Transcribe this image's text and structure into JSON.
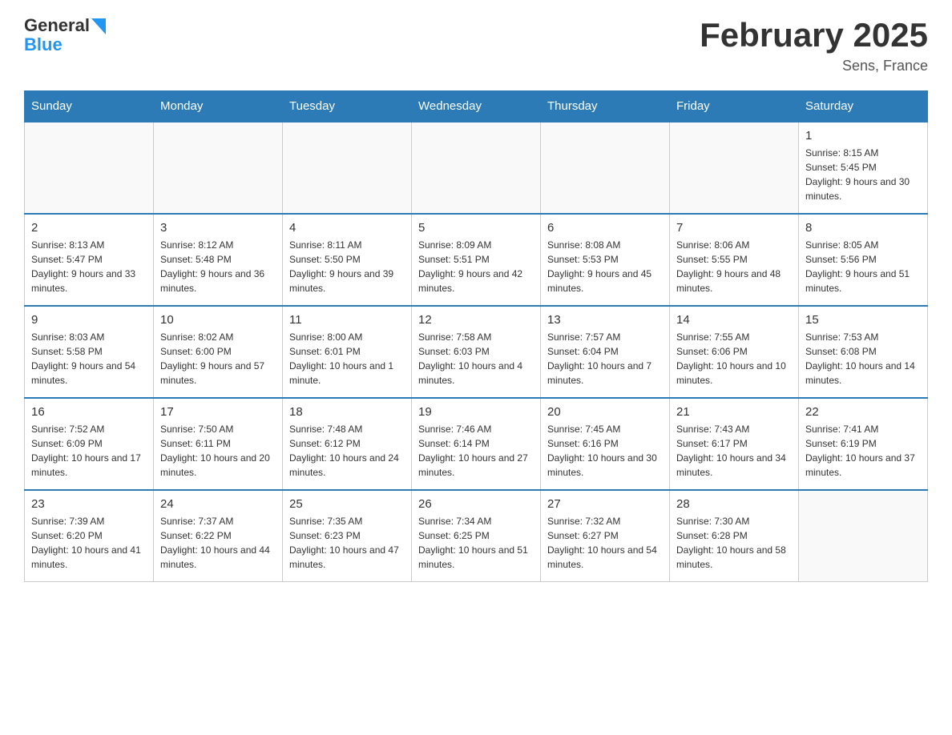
{
  "header": {
    "logo_general": "General",
    "logo_blue": "Blue",
    "month_title": "February 2025",
    "location": "Sens, France"
  },
  "days_of_week": [
    "Sunday",
    "Monday",
    "Tuesday",
    "Wednesday",
    "Thursday",
    "Friday",
    "Saturday"
  ],
  "weeks": [
    {
      "days": [
        {
          "number": "",
          "info": ""
        },
        {
          "number": "",
          "info": ""
        },
        {
          "number": "",
          "info": ""
        },
        {
          "number": "",
          "info": ""
        },
        {
          "number": "",
          "info": ""
        },
        {
          "number": "",
          "info": ""
        },
        {
          "number": "1",
          "info": "Sunrise: 8:15 AM\nSunset: 5:45 PM\nDaylight: 9 hours and 30 minutes."
        }
      ]
    },
    {
      "days": [
        {
          "number": "2",
          "info": "Sunrise: 8:13 AM\nSunset: 5:47 PM\nDaylight: 9 hours and 33 minutes."
        },
        {
          "number": "3",
          "info": "Sunrise: 8:12 AM\nSunset: 5:48 PM\nDaylight: 9 hours and 36 minutes."
        },
        {
          "number": "4",
          "info": "Sunrise: 8:11 AM\nSunset: 5:50 PM\nDaylight: 9 hours and 39 minutes."
        },
        {
          "number": "5",
          "info": "Sunrise: 8:09 AM\nSunset: 5:51 PM\nDaylight: 9 hours and 42 minutes."
        },
        {
          "number": "6",
          "info": "Sunrise: 8:08 AM\nSunset: 5:53 PM\nDaylight: 9 hours and 45 minutes."
        },
        {
          "number": "7",
          "info": "Sunrise: 8:06 AM\nSunset: 5:55 PM\nDaylight: 9 hours and 48 minutes."
        },
        {
          "number": "8",
          "info": "Sunrise: 8:05 AM\nSunset: 5:56 PM\nDaylight: 9 hours and 51 minutes."
        }
      ]
    },
    {
      "days": [
        {
          "number": "9",
          "info": "Sunrise: 8:03 AM\nSunset: 5:58 PM\nDaylight: 9 hours and 54 minutes."
        },
        {
          "number": "10",
          "info": "Sunrise: 8:02 AM\nSunset: 6:00 PM\nDaylight: 9 hours and 57 minutes."
        },
        {
          "number": "11",
          "info": "Sunrise: 8:00 AM\nSunset: 6:01 PM\nDaylight: 10 hours and 1 minute."
        },
        {
          "number": "12",
          "info": "Sunrise: 7:58 AM\nSunset: 6:03 PM\nDaylight: 10 hours and 4 minutes."
        },
        {
          "number": "13",
          "info": "Sunrise: 7:57 AM\nSunset: 6:04 PM\nDaylight: 10 hours and 7 minutes."
        },
        {
          "number": "14",
          "info": "Sunrise: 7:55 AM\nSunset: 6:06 PM\nDaylight: 10 hours and 10 minutes."
        },
        {
          "number": "15",
          "info": "Sunrise: 7:53 AM\nSunset: 6:08 PM\nDaylight: 10 hours and 14 minutes."
        }
      ]
    },
    {
      "days": [
        {
          "number": "16",
          "info": "Sunrise: 7:52 AM\nSunset: 6:09 PM\nDaylight: 10 hours and 17 minutes."
        },
        {
          "number": "17",
          "info": "Sunrise: 7:50 AM\nSunset: 6:11 PM\nDaylight: 10 hours and 20 minutes."
        },
        {
          "number": "18",
          "info": "Sunrise: 7:48 AM\nSunset: 6:12 PM\nDaylight: 10 hours and 24 minutes."
        },
        {
          "number": "19",
          "info": "Sunrise: 7:46 AM\nSunset: 6:14 PM\nDaylight: 10 hours and 27 minutes."
        },
        {
          "number": "20",
          "info": "Sunrise: 7:45 AM\nSunset: 6:16 PM\nDaylight: 10 hours and 30 minutes."
        },
        {
          "number": "21",
          "info": "Sunrise: 7:43 AM\nSunset: 6:17 PM\nDaylight: 10 hours and 34 minutes."
        },
        {
          "number": "22",
          "info": "Sunrise: 7:41 AM\nSunset: 6:19 PM\nDaylight: 10 hours and 37 minutes."
        }
      ]
    },
    {
      "days": [
        {
          "number": "23",
          "info": "Sunrise: 7:39 AM\nSunset: 6:20 PM\nDaylight: 10 hours and 41 minutes."
        },
        {
          "number": "24",
          "info": "Sunrise: 7:37 AM\nSunset: 6:22 PM\nDaylight: 10 hours and 44 minutes."
        },
        {
          "number": "25",
          "info": "Sunrise: 7:35 AM\nSunset: 6:23 PM\nDaylight: 10 hours and 47 minutes."
        },
        {
          "number": "26",
          "info": "Sunrise: 7:34 AM\nSunset: 6:25 PM\nDaylight: 10 hours and 51 minutes."
        },
        {
          "number": "27",
          "info": "Sunrise: 7:32 AM\nSunset: 6:27 PM\nDaylight: 10 hours and 54 minutes."
        },
        {
          "number": "28",
          "info": "Sunrise: 7:30 AM\nSunset: 6:28 PM\nDaylight: 10 hours and 58 minutes."
        },
        {
          "number": "",
          "info": ""
        }
      ]
    }
  ]
}
